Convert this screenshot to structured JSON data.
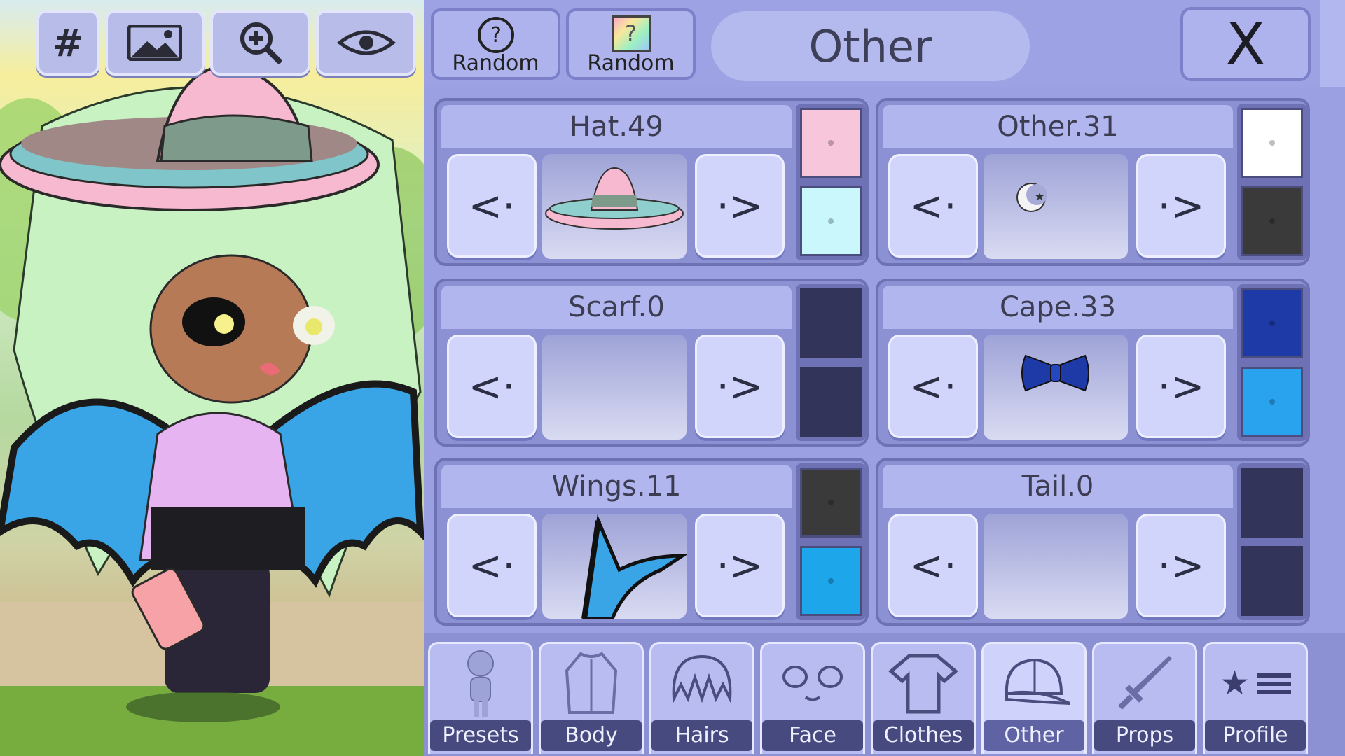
{
  "toolbar": {
    "grid_label": "#",
    "icons": [
      "image-icon",
      "zoom-in-icon",
      "eye-icon"
    ]
  },
  "header": {
    "random_label_1": "Random",
    "random_label_2": "Random",
    "random_icon_2": "?",
    "title": "Other",
    "close_label": "X"
  },
  "slots": [
    {
      "name": "Hat.49",
      "color1": "#f7c6da",
      "color2": "#c9f7fb",
      "item": "sombrero"
    },
    {
      "name": "Other.31",
      "color1": "#ffffff",
      "color2": "#3a3a3a",
      "item": "moon-clip"
    },
    {
      "name": "Scarf.0",
      "color1": "#33345a",
      "color2": "#33345a",
      "item": "none"
    },
    {
      "name": "Cape.33",
      "color1": "#1d3aa6",
      "color2": "#2aa3ee",
      "item": "bow-tie"
    },
    {
      "name": "Wings.11",
      "color1": "#3a3a3a",
      "color2": "#1ea6ea",
      "item": "bat-wing"
    },
    {
      "name": "Tail.0",
      "color1": "#33345a",
      "color2": "#33345a",
      "item": "none"
    }
  ],
  "nav": {
    "prev": "<·",
    "next": "·>"
  },
  "tabs": [
    {
      "label": "Presets",
      "icon": "person-icon"
    },
    {
      "label": "Body",
      "icon": "body-icon"
    },
    {
      "label": "Hairs",
      "icon": "hair-icon"
    },
    {
      "label": "Face",
      "icon": "face-icon"
    },
    {
      "label": "Clothes",
      "icon": "shirt-icon"
    },
    {
      "label": "Other",
      "icon": "cap-icon",
      "active": true
    },
    {
      "label": "Props",
      "icon": "sword-icon"
    },
    {
      "label": "Profile",
      "icon": "star-list-icon"
    }
  ]
}
